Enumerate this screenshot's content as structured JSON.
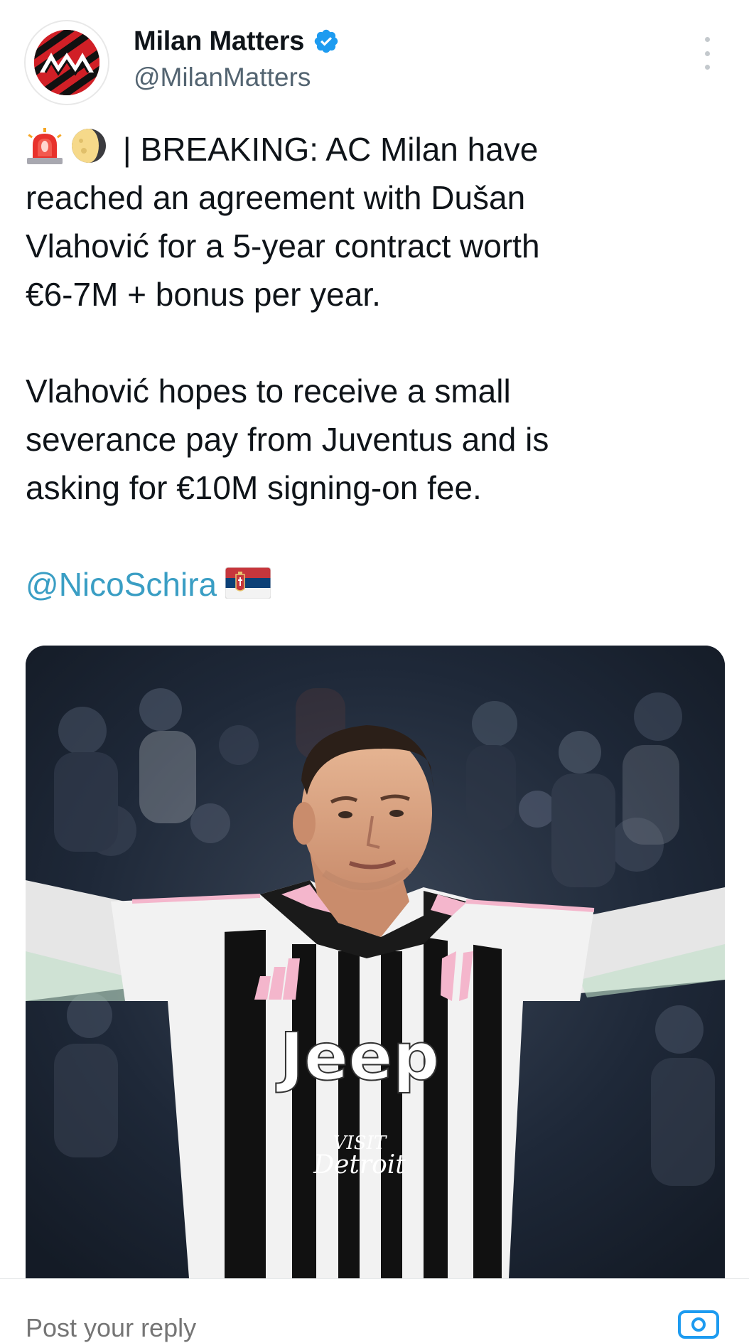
{
  "account": {
    "display_name": "Milan Matters",
    "handle": "@MilanMatters",
    "verified": true,
    "avatar_icon": "milan-matters-logo",
    "verified_icon": "verified-badge-icon"
  },
  "menu": {
    "icon": "more-vertical-icon"
  },
  "tweet": {
    "lines": [
      " | BREAKING: AC Milan have",
      "reached an agreement with Dušan",
      "Vlahović for a 5-year contract worth",
      "€6-7M + bonus per year."
    ],
    "paragraph2": [
      "Vlahović hopes to receive a small",
      "severance pay from Juventus and is",
      "asking for €10M signing-on fee."
    ],
    "mention": "@NicoSchira",
    "emojis": [
      "siren-emoji",
      "moon-emoji",
      "serbia-flag-emoji"
    ]
  },
  "media": {
    "jersey_sponsor": "Jeep",
    "jersey_sub": "VISIT",
    "jersey_sub2": "Detroit",
    "colors": {
      "background": "#1d2838",
      "stripe_black": "#111111",
      "stripe_white": "#f2f2f2",
      "pink": "#f4b6cc"
    }
  },
  "reply": {
    "placeholder": "Post your reply",
    "camera_icon": "camera-icon"
  },
  "colors": {
    "text": "#0f1419",
    "secondary": "#536471",
    "link": "#3a9ec4",
    "verified": "#1d9bf0"
  }
}
